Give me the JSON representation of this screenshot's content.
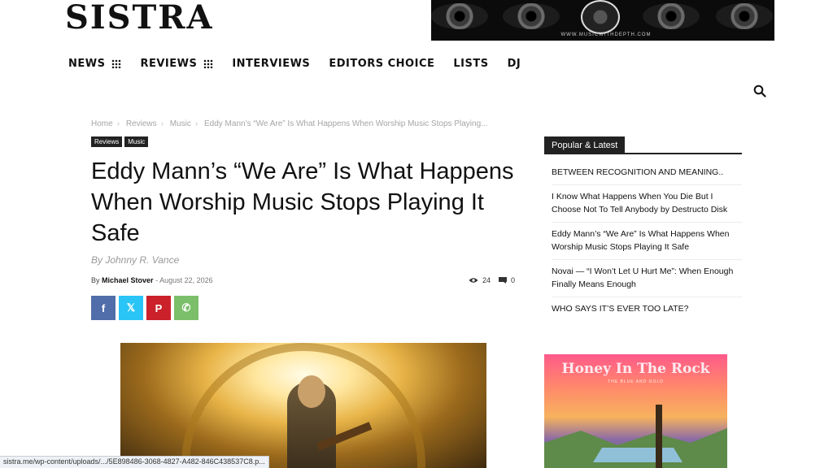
{
  "site": {
    "logo": "SISTRA"
  },
  "banner": {
    "url": "WWW.MUSICWITHDEPTH.COM"
  },
  "nav": {
    "items": [
      {
        "label": "NEWS",
        "has_menu": true
      },
      {
        "label": "REVIEWS",
        "has_menu": true
      },
      {
        "label": "INTERVIEWS",
        "has_menu": false
      },
      {
        "label": "EDITORS CHOICE",
        "has_menu": false
      },
      {
        "label": "LISTS",
        "has_menu": false
      },
      {
        "label": "DJ",
        "has_menu": false
      }
    ]
  },
  "breadcrumb": [
    "Home",
    "Reviews",
    "Music",
    "Eddy Mann’s “We Are” Is What Happens When Worship Music Stops Playing..."
  ],
  "tags": [
    "Reviews",
    "Music"
  ],
  "article": {
    "title": "Eddy Mann’s “We Are” Is What Happens When Worship Music Stops Playing It Safe",
    "byline": "By Johnny R. Vance",
    "by_prefix": "By",
    "author": "Michael Stover",
    "separator": "-",
    "date": "August 22, 2026",
    "views": "24",
    "comments": "0"
  },
  "share": [
    {
      "name": "facebook",
      "glyph": "f",
      "color": "#516eab"
    },
    {
      "name": "x",
      "glyph": "𝕏",
      "color": "#29c5f6"
    },
    {
      "name": "pinterest",
      "glyph": "P",
      "color": "#ca212a"
    },
    {
      "name": "whatsapp",
      "glyph": "✆",
      "color": "#7bbf6a"
    }
  ],
  "sidebar": {
    "heading": "Popular & Latest",
    "items": [
      "BETWEEN RECOGNITION AND MEANING..",
      "I Know What Happens When You Die But I Choose Not To Tell Anybody by Destructo Disk",
      "Eddy Mann’s “We Are” Is What Happens When Worship Music Stops Playing It Safe",
      "Novai — “I Won’t Let U Hurt Me”: When Enough Finally Means Enough",
      "WHO SAYS IT’S EVER TOO LATE?"
    ]
  },
  "ad": {
    "title": "Honey In The Rock",
    "subtitle": "THE BLUE AND GOLD"
  },
  "status_bar": {
    "url": "sistra.me/wp-content/uploads/.../5E898486-3068-4827-A482-846C438537C8.p..."
  }
}
